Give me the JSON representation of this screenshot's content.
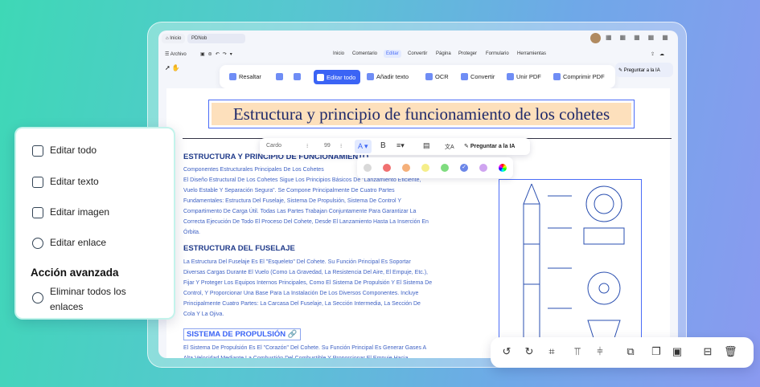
{
  "tabs": {
    "home": "Inicio",
    "doc": "PDNob"
  },
  "menu": {
    "file": "Archivo",
    "items": [
      "Inicio",
      "Comentario",
      "Editar",
      "Convertir",
      "Página",
      "Proteger",
      "Formulario",
      "Herramientas"
    ],
    "selected": "Editar"
  },
  "ribbon": {
    "highlight": "Resaltar",
    "edit_all": "Editar todo",
    "add_text": "Añadir texto",
    "ocr": "OCR",
    "convert": "Convertir",
    "merge": "Unir PDF",
    "compress": "Comprimir PDF"
  },
  "ask_ai": "Preguntar a la IA",
  "format_bar": {
    "font": "Cardo",
    "size": "99",
    "ask_ai": "Preguntar a la IA"
  },
  "colors": [
    "#d9d9d9",
    "#f07070",
    "#f5b07a",
    "#f5ee8a",
    "#7fdc7f",
    "#6b86e8",
    "#cfa4f0",
    "rainbow"
  ],
  "selected_color": "#6b86e8",
  "doc": {
    "title": "Estructura y principio de funcionamiento de los cohetes",
    "s1_title": "ESTRUCTURA Y PRINCIPIO DE FUNCIONAMIENTO",
    "s1_lines": [
      "Componentes Estructurales Principales De Los Cohetes",
      "El Diseño Estructural De Los Cohetes Sigue Los Principios Básicos De \"Lanzamiento Eficiente,",
      "Vuelo Estable Y Separación Segura\". Se Compone Principalmente De Cuatro Partes",
      "Fundamentales: Estructura Del Fuselaje, Sistema De Propulsión, Sistema De Control Y",
      "Compartimento De Carga Útil. Todas Las Partes Trabajan Conjuntamente Para Garantizar La",
      "Correcta Ejecución De Todo El Proceso Del Cohete, Desde El Lanzamiento Hasta La Inserción En",
      "Órbita."
    ],
    "s2_title": "ESTRUCTURA DEL FUSELAJE",
    "s2_lines": [
      "La Estructura Del Fuselaje Es El \"Esqueleto\" Del Cohete. Su Función Principal Es Soportar",
      "Diversas Cargas Durante El Vuelo (Como La Gravedad, La Resistencia Del Aire, El Empuje, Etc.),",
      "Fijar Y Proteger Los Equipos Internos Principales, Como El Sistema De Propulsión Y El Sistema De",
      "Control, Y Proporcionar Una Base Para La Instalación De Los Diversos Componentes. Incluye",
      "Principalmente Cuatro Partes: La Carcasa Del Fuselaje, La Sección Intermedia, La Sección De",
      "Cola Y La Ojiva."
    ],
    "s3_title": "SISTEMA DE PROPULSIÓN",
    "s3_lines": [
      "El Sistema De Propulsión Es El \"Corazón\" Del Cohete. Su Función Principal Es Generar Gases A",
      "Alta Velocidad Mediante La Combustión Del Combustible Y Proporcionar El Empuje Hacia"
    ]
  },
  "left_panel": {
    "items": [
      "Editar todo",
      "Editar texto",
      "Editar imagen",
      "Editar enlace"
    ],
    "advanced": "Acción avanzada",
    "remove_links": "Eliminar todos los",
    "remove_links_2": "enlaces"
  },
  "bottom_tools": [
    "rotate-left",
    "rotate-right",
    "crop",
    "align-top",
    "align-middle",
    "replace",
    "copy",
    "save",
    "extract",
    "delete"
  ]
}
